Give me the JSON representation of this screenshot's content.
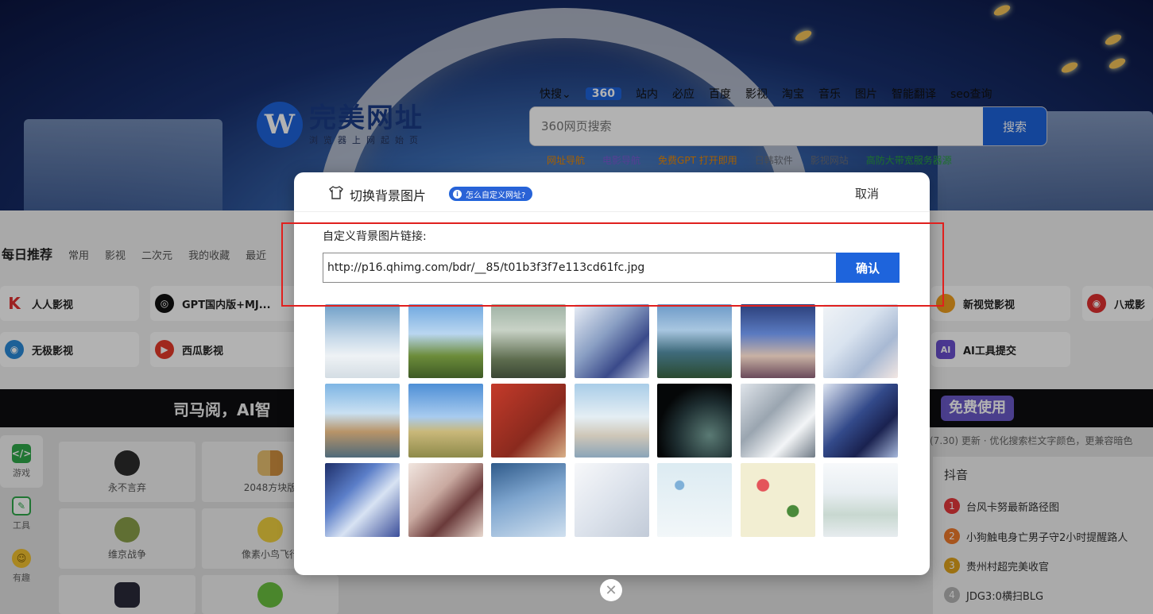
{
  "header": {
    "logo_mark": "W",
    "logo_title": "完美网址",
    "logo_subtitle": "浏览器上网起始页",
    "engines": [
      "快搜⌄",
      "360",
      "站内",
      "必应",
      "百度",
      "影视",
      "淘宝",
      "音乐",
      "图片",
      "智能翻译",
      "seo查询"
    ],
    "search_placeholder": "360网页搜索",
    "search_button": "搜索",
    "quick_links": [
      "网址导航",
      "电影导航",
      "免费GPT 打开即用",
      "日韩软件",
      "影视网站",
      "高防大带宽服务器源"
    ]
  },
  "tabs": {
    "active": "每日推荐",
    "items": [
      "常用",
      "影视",
      "二次元",
      "我的收藏",
      "最近"
    ]
  },
  "cards": [
    "人人影视",
    "GPT国内版+MJ...",
    "新视觉影视",
    "八戒影",
    "无极影视",
    "西瓜影视",
    "AI工具提交"
  ],
  "banner": {
    "left": "司马阅，AI智",
    "right": "免费使用"
  },
  "sidenav": [
    "游戏",
    "工具",
    "有趣"
  ],
  "games": [
    "永不言弃",
    "2048方块版",
    "维京战争",
    "像素小鸟飞行"
  ],
  "notice": "(7.30) 更新 · 优化搜索栏文字颜色，更兼容暗色",
  "hot": {
    "title": "抖音",
    "items": [
      "台风卡努最新路径图",
      "小狗触电身亡男子守2小时提醒路人",
      "贵州村超完美收官",
      "JDG3:0横扫BLG"
    ],
    "rank_colors": [
      "#e5383b",
      "#f07a2c",
      "#e0a21b",
      "#b5b5b5"
    ]
  },
  "modal": {
    "title": "切换背景图片",
    "help": "怎么自定义网址?",
    "help_icon": "i",
    "cancel": "取消",
    "url_label": "自定义背景图片链接:",
    "url_value": "http://p16.qhimg.com/bdr/__85/t01b3f3f7e113cd61fc.jpg",
    "confirm": "确认",
    "thumbnails": [
      "linear-gradient(#6f9fc8,#c7d9e9 45%,#eef2f5 70%,#d4dde4)",
      "linear-gradient(#6fa8e0,#b9d6f0 40%,#6c8c3a 70%,#3e5a25)",
      "linear-gradient(#9fb3a5,#c8d2c6 35%,#5d6c4e 75%,#3a4634)",
      "linear-gradient(135deg,#e9eef6,#8ba0c4 40%,#3a4a8a 70%,#c3cee2)",
      "linear-gradient(#6d9ac8,#a8c6e0 35%,#3f6b7c 65%,#2a4a2f)",
      "linear-gradient(#2b3f7a,#5a7ac0 40%,#c8b1a4 70%,#6a4a5a)",
      "linear-gradient(135deg,#f0f3f6,#d9e3ef 40%,#a8b9d3 70%,#f3e7e3)",
      "linear-gradient(#7eb5e4,#c9e0f2 40%,#b89468 65%,#4f6a7a)",
      "linear-gradient(#4e8fd6,#a8cbef 45%,#c9b87a 65%,#8e8a4a)",
      "linear-gradient(135deg,#c43a2a,#8a2a1e 60%,#d8b088)",
      "linear-gradient(#a9cde8,#e4eef4 45%,#cfc7b8 70%,#8aa4b8)",
      "radial-gradient(circle at 70% 70%,#5a7a74,#1d2d30 45%,#050708 70%)",
      "linear-gradient(135deg,#dfe4ea,#9aa5b0 40%,#f3f5f7 70%,#6f7a85)",
      "linear-gradient(135deg,#dfe6f2,#334a8a 45%,#1a2250 70%,#a8b9dc)",
      "linear-gradient(135deg,#1e2f6a,#5b7ec8 35%,#d8e3f3 60%,#3b4e9a)",
      "linear-gradient(135deg,#f1e6e0,#c9a9a0 40%,#6a3a3a 65%,#e9d9cf)",
      "linear-gradient(160deg,#2f5a8a,#7fa6cf 45%,#d0e0ef)",
      "linear-gradient(135deg,#f7f8fa,#dde3ec 50%,#c2cbd8)",
      "radial-gradient(circle at 30% 30%,#7fb0d8 0 6%,transparent 7%),linear-gradient(#dcebf2,#f2f7f9)",
      "radial-gradient(circle at 30% 30%,#e4545a 0 8%,transparent 9%),radial-gradient(circle at 70% 65%,#4a8a3a 0 8%,transparent 9%),#f2eed2",
      "linear-gradient(#f7f9fb,#e8eef2 40%,#c8d8d0 70%,#e7ecef)"
    ]
  }
}
